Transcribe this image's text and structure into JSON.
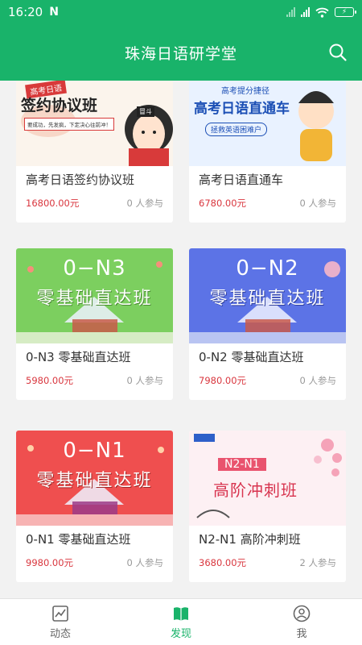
{
  "status_bar": {
    "time": "16:20",
    "notification_glyph": "N",
    "battery": "⚡"
  },
  "header": {
    "title": "珠海日语研学堂",
    "search_icon": "search-icon"
  },
  "courses": [
    {
      "title": "高考日语签约协议班",
      "price": "16800.00元",
      "participants": "0 人参与",
      "banner": {
        "tag": "高考日语",
        "text": "签约协议班",
        "sub": "要成功，先发疯，下定决心往前冲！",
        "badge": "冒斗"
      }
    },
    {
      "title": "高考日语直通车",
      "price": "6780.00元",
      "participants": "0 人参与",
      "banner": {
        "tag": "高考提分捷径",
        "text": "高考日语直通车",
        "sub": "拯救英语困难户"
      }
    },
    {
      "title": "0-N3 零基础直达班",
      "price": "5980.00元",
      "participants": "0 人参与",
      "banner": {
        "line1": "0−N3",
        "line2": "零基础直达班"
      }
    },
    {
      "title": "0-N2 零基础直达班",
      "price": "7980.00元",
      "participants": "0 人参与",
      "banner": {
        "line1": "0−N2",
        "line2": "零基础直达班"
      }
    },
    {
      "title": "0-N1 零基础直达班",
      "price": "9980.00元",
      "participants": "0 人参与",
      "banner": {
        "line1": "0−N1",
        "line2": "零基础直达班"
      }
    },
    {
      "title": "N2-N1 高阶冲刺班",
      "price": "3680.00元",
      "participants": "2 人参与",
      "banner": {
        "line1": "N2-N1",
        "line2": "高阶冲刺班"
      }
    }
  ],
  "bottom_nav": [
    {
      "label": "动态",
      "icon": "activity-chart-icon",
      "active": false
    },
    {
      "label": "发现",
      "icon": "book-icon",
      "active": true
    },
    {
      "label": "我",
      "icon": "profile-icon",
      "active": false
    }
  ],
  "colors": {
    "primary": "#19b36a",
    "price": "#d9363e",
    "n3": "#7ccf5f",
    "n2": "#5c73e6",
    "n1": "#ef4f4f"
  }
}
